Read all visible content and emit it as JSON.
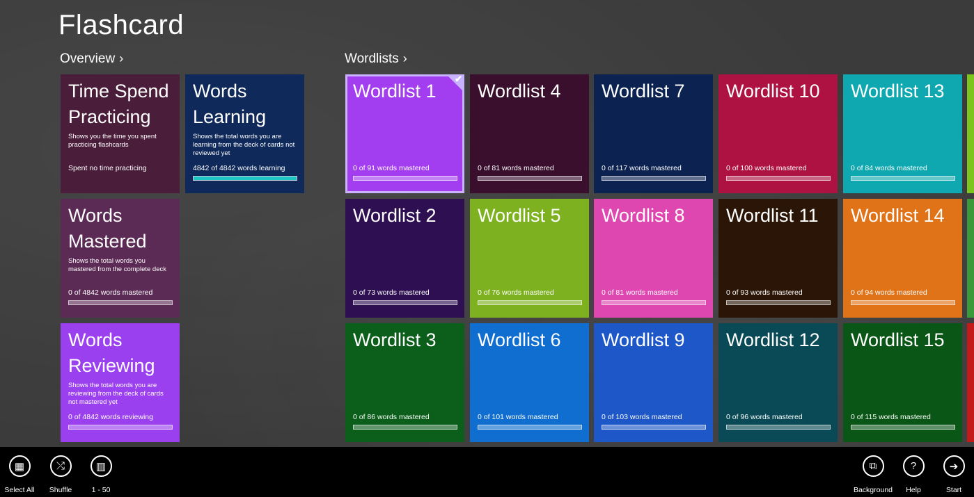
{
  "app": {
    "title": "Flashcard"
  },
  "groups": {
    "overview": "Overview",
    "wordlists": "Wordlists",
    "chevron": "›"
  },
  "overview_tiles": [
    {
      "title": "Time Spend Practicing",
      "desc": "Shows you the time you spent practicing flashcards",
      "status": "Spent no time practicing",
      "color": "#4a1d3a",
      "show_progress": false
    },
    {
      "title": "Words Learning",
      "desc": "Shows the total words you are learning from the deck of cards not reviewed yet",
      "status": "4842 of 4842 words learning",
      "color": "#0f2a5a",
      "progress": 1.0,
      "progress_color": "#1ec5c5"
    },
    {
      "title": "Words Mastered",
      "desc": "Shows the total words you mastered from the complete deck",
      "status": "0 of 4842 words mastered",
      "color": "#5b2a55",
      "progress": 0.0
    },
    {
      "title": "Words Reviewing",
      "desc": "Shows the total words you are reviewing from the deck of cards not mastered yet",
      "status": "0 of 4842 words reviewing",
      "color": "#9a40ef",
      "progress": 0.0
    }
  ],
  "wordlists": [
    {
      "title": "Wordlist 1",
      "status": "0 of 91 words mastered",
      "color": "#a33ef0",
      "selected": true,
      "progress": 0.0
    },
    {
      "title": "Wordlist 2",
      "status": "0 of 73 words mastered",
      "color": "#2e0f52",
      "progress": 0.0
    },
    {
      "title": "Wordlist 3",
      "status": "0 of 86 words mastered",
      "color": "#0b5f1a",
      "progress": 0.0
    },
    {
      "title": "Wordlist 4",
      "status": "0 of 81 words mastered",
      "color": "#3a0f2e",
      "progress": 0.0
    },
    {
      "title": "Wordlist 5",
      "status": "0 of 76 words mastered",
      "color": "#7db120",
      "progress": 0.0
    },
    {
      "title": "Wordlist 6",
      "status": "0 of 101 words mastered",
      "color": "#0f6ecf",
      "progress": 0.0
    },
    {
      "title": "Wordlist 7",
      "status": "0 of 117 words mastered",
      "color": "#0c2352",
      "progress": 0.0
    },
    {
      "title": "Wordlist 8",
      "status": "0 of 81 words mastered",
      "color": "#df47b0",
      "progress": 0.0
    },
    {
      "title": "Wordlist 9",
      "status": "0 of 103 words mastered",
      "color": "#1d57c8",
      "progress": 0.0
    },
    {
      "title": "Wordlist 10",
      "status": "0 of 100 words mastered",
      "color": "#ad1242",
      "progress": 0.0
    },
    {
      "title": "Wordlist 11",
      "status": "0 of 93 words mastered",
      "color": "#2b1506",
      "progress": 0.0
    },
    {
      "title": "Wordlist 12",
      "status": "0 of 96 words mastered",
      "color": "#0a4a56",
      "progress": 0.0
    },
    {
      "title": "Wordlist 13",
      "status": "0 of 84 words mastered",
      "color": "#0fa8b0",
      "progress": 0.0
    },
    {
      "title": "Wordlist 14",
      "status": "0 of 94 words mastered",
      "color": "#e07218",
      "progress": 0.0
    },
    {
      "title": "Wordlist 15",
      "status": "0 of 115 words mastered",
      "color": "#0a5616",
      "progress": 0.0
    }
  ],
  "edge_colors": [
    "#7cc41e",
    "#3a9a3a",
    "#c41a1a"
  ],
  "appbar": {
    "left": [
      {
        "label": "Select All",
        "icon": "select-all-icon",
        "glyph": "▦"
      },
      {
        "label": "Shuffle",
        "icon": "shuffle-icon",
        "glyph": "⤮"
      },
      {
        "label": "1 - 50",
        "icon": "books-icon",
        "glyph": "▥"
      }
    ],
    "right": [
      {
        "label": "Background",
        "icon": "background-icon",
        "glyph": "⧉"
      },
      {
        "label": "Help",
        "icon": "help-icon",
        "glyph": "?"
      },
      {
        "label": "Start",
        "icon": "start-arrow-icon",
        "glyph": "➔"
      }
    ]
  }
}
